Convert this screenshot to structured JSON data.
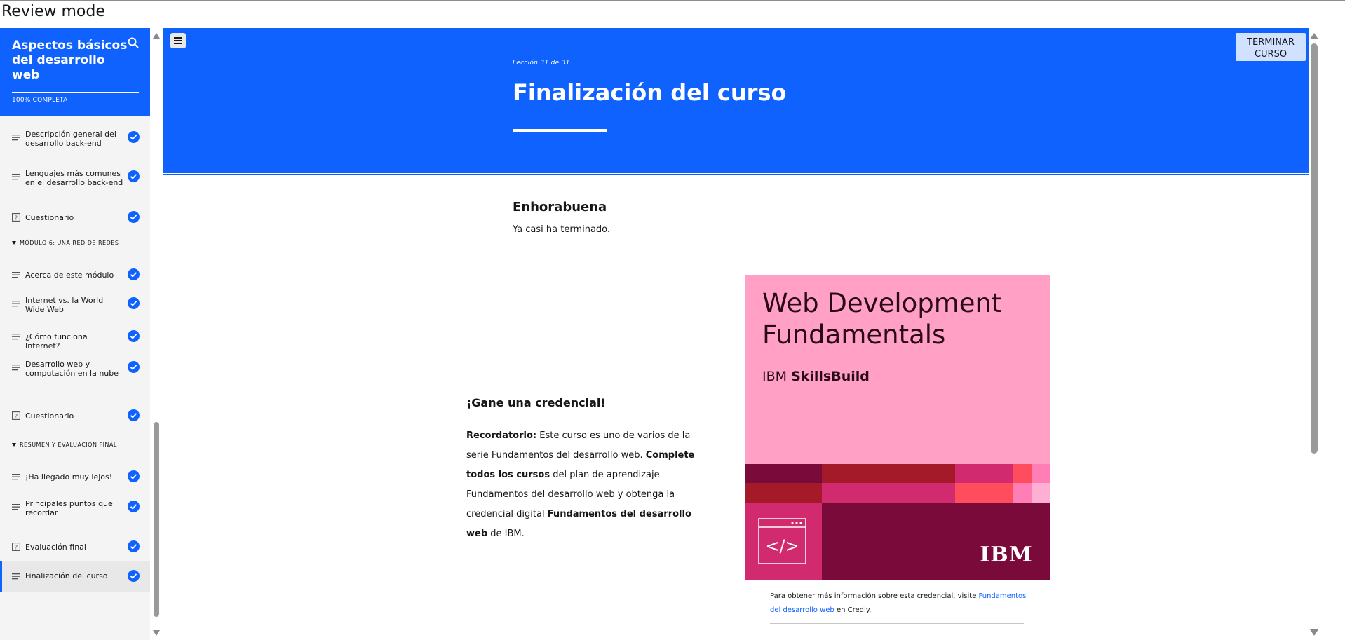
{
  "app": {
    "mode_label": "Review mode"
  },
  "sidebar": {
    "course_title": "Aspectos básicos del desarrollo web",
    "progress_label": "100% COMPLETA",
    "items": [
      {
        "label": "Descripción general del desarrollo back-end",
        "icon": "lines-icon",
        "completed": true
      },
      {
        "label": "Lenguajes más comunes en el desarrollo back-end",
        "icon": "lines-icon",
        "completed": true
      },
      {
        "label": "Cuestionario",
        "icon": "quiz-icon",
        "completed": true
      },
      {
        "label": "Acerca de este módulo",
        "icon": "lines-icon",
        "completed": true
      },
      {
        "label": "Internet vs. la World Wide Web",
        "icon": "lines-icon",
        "completed": true
      },
      {
        "label": "¿Cómo funciona Internet?",
        "icon": "lines-icon",
        "completed": true
      },
      {
        "label": "Desarrollo web y computación en la nube",
        "icon": "lines-icon",
        "completed": true
      },
      {
        "label": "Cuestionario",
        "icon": "quiz-icon",
        "completed": true
      },
      {
        "label": "¡Ha llegado muy lejos!",
        "icon": "lines-icon",
        "completed": true
      },
      {
        "label": "Principales puntos que recordar",
        "icon": "lines-icon",
        "completed": true
      },
      {
        "label": "Evaluación final",
        "icon": "quiz-icon",
        "completed": true
      },
      {
        "label": "Finalización del curso",
        "icon": "lines-icon",
        "completed": true
      }
    ],
    "modules": [
      {
        "label": "MÓDULO 6: UNA RED DE REDES"
      },
      {
        "label": "RESUMEN Y EVALUACIÓN FINAL"
      }
    ]
  },
  "header": {
    "lesson_number": "Lección 31 de 31",
    "lesson_title": "Finalización del curso",
    "finish_button": "TERMINAR CURSO"
  },
  "content": {
    "congrats_heading": "Enhorabuena",
    "congrats_text": "Ya casi ha terminado.",
    "credential_heading": "¡Gane una credencial!",
    "credential_parts": {
      "reminder_bold": "Recordatorio:",
      "text1": " Este curso es uno de varios de la serie Fundamentos del desarrollo web. ",
      "complete_bold": "Complete todos los cursos",
      "text2": " del plan de aprendizaje Fundamentos del desarrollo web y obtenga la credencial digital ",
      "credential_bold": "Fundamentos del desarrollo web",
      "text3": " de IBM."
    },
    "badge": {
      "title": "Web Development Fundamentals",
      "brand_prefix": "IBM ",
      "brand_bold": "SkillsBuild",
      "logo_text": "IBM",
      "code_symbol": "</>"
    },
    "note": {
      "prefix": "Para obtener más información sobre esta credencial, visite ",
      "link": "Fundamentos del desarrollo web",
      "suffix": " en Credly."
    }
  },
  "colors": {
    "accent": "#0f62fe",
    "badge_pink": "#ffa0c4",
    "badge_dark": "#7a0a3a"
  }
}
